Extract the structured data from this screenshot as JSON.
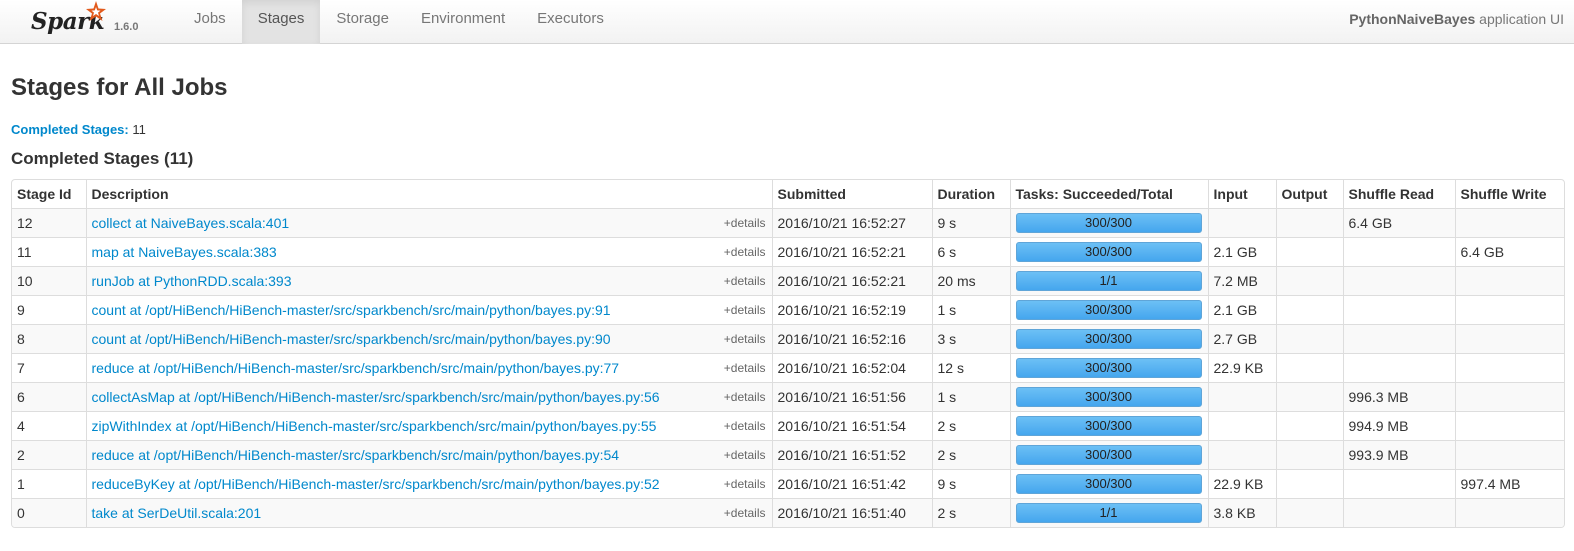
{
  "brand": {
    "name": "Spark",
    "version": "1.6.0",
    "star_color": "#e25a1c"
  },
  "nav": {
    "items": [
      "Jobs",
      "Stages",
      "Storage",
      "Environment",
      "Executors"
    ],
    "active": "Stages"
  },
  "app": {
    "name": "PythonNaiveBayes",
    "suffix": "application UI"
  },
  "page": {
    "title": "Stages for All Jobs",
    "summary_label": "Completed Stages:",
    "summary_value": "11",
    "section_title": "Completed Stages (11)"
  },
  "colors": {
    "link": "#0088cc",
    "progress": "#45a6ee"
  },
  "table": {
    "headers": [
      "Stage Id",
      "Description",
      "Submitted",
      "Duration",
      "Tasks: Succeeded/Total",
      "Input",
      "Output",
      "Shuffle Read",
      "Shuffle Write"
    ],
    "details_label": "+details",
    "rows": [
      {
        "id": "12",
        "description": "collect at NaiveBayes.scala:401",
        "submitted": "2016/10/21 16:52:27",
        "duration": "9 s",
        "tasks": "300/300",
        "progress": 1.0,
        "input": "",
        "output": "",
        "shuffle_read": "6.4 GB",
        "shuffle_write": ""
      },
      {
        "id": "11",
        "description": "map at NaiveBayes.scala:383",
        "submitted": "2016/10/21 16:52:21",
        "duration": "6 s",
        "tasks": "300/300",
        "progress": 1.0,
        "input": "2.1 GB",
        "output": "",
        "shuffle_read": "",
        "shuffle_write": "6.4 GB"
      },
      {
        "id": "10",
        "description": "runJob at PythonRDD.scala:393",
        "submitted": "2016/10/21 16:52:21",
        "duration": "20 ms",
        "tasks": "1/1",
        "progress": 1.0,
        "input": "7.2 MB",
        "output": "",
        "shuffle_read": "",
        "shuffle_write": ""
      },
      {
        "id": "9",
        "description": "count at /opt/HiBench/HiBench-master/src/sparkbench/src/main/python/bayes.py:91",
        "submitted": "2016/10/21 16:52:19",
        "duration": "1 s",
        "tasks": "300/300",
        "progress": 1.0,
        "input": "2.1 GB",
        "output": "",
        "shuffle_read": "",
        "shuffle_write": ""
      },
      {
        "id": "8",
        "description": "count at /opt/HiBench/HiBench-master/src/sparkbench/src/main/python/bayes.py:90",
        "submitted": "2016/10/21 16:52:16",
        "duration": "3 s",
        "tasks": "300/300",
        "progress": 1.0,
        "input": "2.7 GB",
        "output": "",
        "shuffle_read": "",
        "shuffle_write": ""
      },
      {
        "id": "7",
        "description": "reduce at /opt/HiBench/HiBench-master/src/sparkbench/src/main/python/bayes.py:77",
        "submitted": "2016/10/21 16:52:04",
        "duration": "12 s",
        "tasks": "300/300",
        "progress": 1.0,
        "input": "22.9 KB",
        "output": "",
        "shuffle_read": "",
        "shuffle_write": ""
      },
      {
        "id": "6",
        "description": "collectAsMap at /opt/HiBench/HiBench-master/src/sparkbench/src/main/python/bayes.py:56",
        "submitted": "2016/10/21 16:51:56",
        "duration": "1 s",
        "tasks": "300/300",
        "progress": 1.0,
        "input": "",
        "output": "",
        "shuffle_read": "996.3 MB",
        "shuffle_write": ""
      },
      {
        "id": "4",
        "description": "zipWithIndex at /opt/HiBench/HiBench-master/src/sparkbench/src/main/python/bayes.py:55",
        "submitted": "2016/10/21 16:51:54",
        "duration": "2 s",
        "tasks": "300/300",
        "progress": 1.0,
        "input": "",
        "output": "",
        "shuffle_read": "994.9 MB",
        "shuffle_write": ""
      },
      {
        "id": "2",
        "description": "reduce at /opt/HiBench/HiBench-master/src/sparkbench/src/main/python/bayes.py:54",
        "submitted": "2016/10/21 16:51:52",
        "duration": "2 s",
        "tasks": "300/300",
        "progress": 1.0,
        "input": "",
        "output": "",
        "shuffle_read": "993.9 MB",
        "shuffle_write": ""
      },
      {
        "id": "1",
        "description": "reduceByKey at /opt/HiBench/HiBench-master/src/sparkbench/src/main/python/bayes.py:52",
        "submitted": "2016/10/21 16:51:42",
        "duration": "9 s",
        "tasks": "300/300",
        "progress": 1.0,
        "input": "22.9 KB",
        "output": "",
        "shuffle_read": "",
        "shuffle_write": "997.4 MB"
      },
      {
        "id": "0",
        "description": "take at SerDeUtil.scala:201",
        "submitted": "2016/10/21 16:51:40",
        "duration": "2 s",
        "tasks": "1/1",
        "progress": 1.0,
        "input": "3.8 KB",
        "output": "",
        "shuffle_read": "",
        "shuffle_write": ""
      }
    ]
  }
}
